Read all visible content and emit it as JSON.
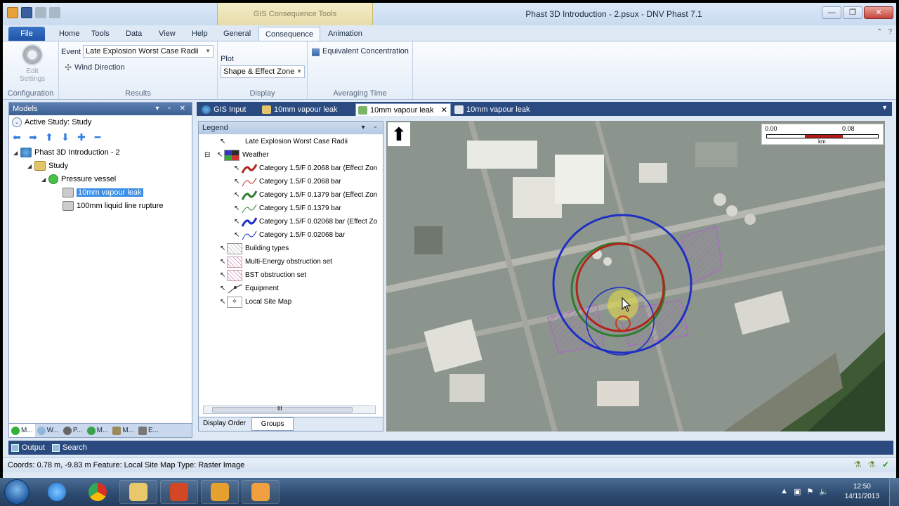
{
  "app": {
    "title": "Phast 3D Introduction - 2.psux - DNV Phast 7.1",
    "context_group": "GIS Consequence Tools"
  },
  "window_buttons": {
    "minimize": "—",
    "restore": "❐",
    "close": "✕"
  },
  "ribbon_tabs": [
    {
      "label": "File"
    },
    {
      "label": "Home"
    },
    {
      "label": "Tools"
    },
    {
      "label": "Data"
    },
    {
      "label": "View"
    },
    {
      "label": "Help"
    },
    {
      "label": "General"
    },
    {
      "label": "Consequence"
    },
    {
      "label": "Animation"
    }
  ],
  "ribbon": {
    "edit_settings": "Edit Settings",
    "configuration_label": "Configuration",
    "event_label": "Event",
    "event_value": "Late Explosion Worst Case Radii",
    "wind_direction": "Wind Direction",
    "results_label": "Results",
    "plot_label": "Plot",
    "plot_value": "Shape & Effect Zone",
    "display_label": "Display",
    "equivalent_concentration": "Equivalent Concentration",
    "averaging_time_label": "Averaging Time"
  },
  "models_panel": {
    "title": "Models",
    "active_study": "Active Study: Study",
    "tree": [
      {
        "label": "Phast 3D Introduction - 2"
      },
      {
        "label": "Study"
      },
      {
        "label": "Pressure vessel"
      },
      {
        "label": "10mm vapour leak"
      },
      {
        "label": "100mm liquid line rupture"
      }
    ],
    "bottom_tabs": [
      {
        "label": "M..."
      },
      {
        "label": "W..."
      },
      {
        "label": "P..."
      },
      {
        "label": "M..."
      },
      {
        "label": "M..."
      },
      {
        "label": "E..."
      }
    ]
  },
  "doc_tabs": [
    {
      "label": "GIS Input"
    },
    {
      "label": "10mm vapour leak"
    },
    {
      "label": "10mm vapour leak"
    },
    {
      "label": "10mm vapour leak"
    }
  ],
  "legend": {
    "title": "Legend",
    "rows": [
      {
        "label": "Late Explosion Worst Case Radii"
      },
      {
        "label": "Weather"
      },
      {
        "label": "Category 1.5/F 0.2068 bar (Effect Zon"
      },
      {
        "label": "Category 1.5/F 0.2068 bar"
      },
      {
        "label": "Category 1.5/F 0.1379 bar (Effect Zon"
      },
      {
        "label": "Category 1.5/F 0.1379 bar"
      },
      {
        "label": "Category 1.5/F 0.02068 bar (Effect Zo"
      },
      {
        "label": "Category 1.5/F 0.02068 bar"
      },
      {
        "label": "Building types"
      },
      {
        "label": "Multi-Energy obstruction set"
      },
      {
        "label": "BST obstruction set"
      },
      {
        "label": "Equipment"
      },
      {
        "label": "Local Site Map"
      }
    ],
    "scroll_thumb": "III",
    "tabs": {
      "display_order": "Display Order",
      "groups": "Groups"
    }
  },
  "map": {
    "scale_left": "0.00",
    "scale_right": "0.08",
    "scale_unit": "km",
    "north": "⬆"
  },
  "output_row": {
    "output": "Output",
    "search": "Search"
  },
  "status": {
    "text": "Coords: 0.78 m, -9.83 m  Feature: Local Site Map  Type: Raster Image"
  },
  "taskbar": {
    "time": "12:50",
    "date": "14/11/2013"
  },
  "colors": {
    "red_zone": "#b0241a",
    "green_zone": "#2e7d2e",
    "blue_zone": "#1e2fc4",
    "obstruction": "#b060c8"
  }
}
